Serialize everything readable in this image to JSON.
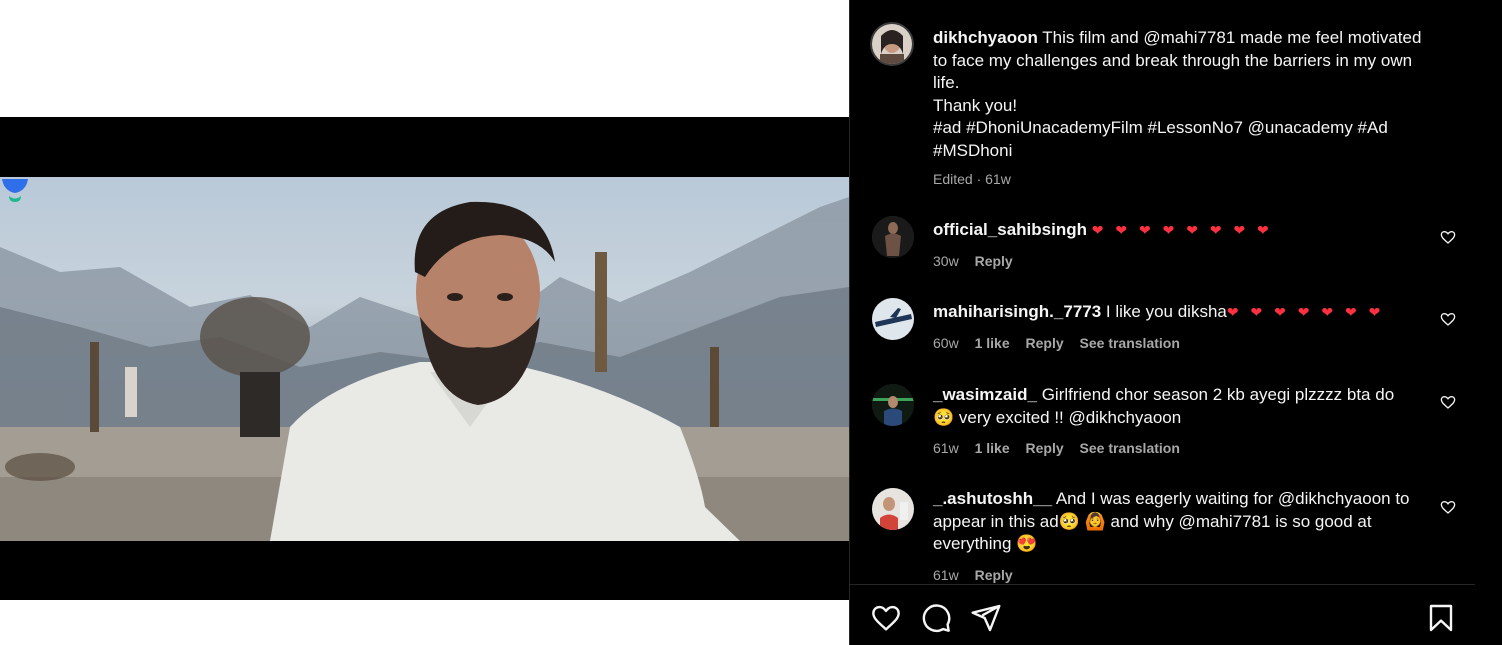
{
  "post": {
    "author": "dikhchyaoon",
    "caption_line1": "This film and @mahi7781 made me feel motivated",
    "caption_line2": "to face my challenges and break through the barriers in my own",
    "caption_line3": "life.",
    "caption_line4": "Thank you!",
    "caption_line5": "#ad #DhoniUnacademyFilm #LessonNo7 @unacademy #Ad",
    "caption_line6": "#MSDhoni",
    "edited": "Edited · 61w"
  },
  "comments": [
    {
      "user": "official_sahibsingh",
      "text": "",
      "hearts": "❤ ❤ ❤ ❤ ❤ ❤ ❤ ❤",
      "age": "30w",
      "reply": "Reply"
    },
    {
      "user": "mahiharisingh._7773",
      "text": "I like you diksha",
      "hearts": "❤ ❤ ❤ ❤ ❤ ❤ ❤",
      "age": "60w",
      "likes": "1 like",
      "reply": "Reply",
      "translate": "See translation"
    },
    {
      "user": "_wasimzaid_",
      "text_line1": "Girlfriend chor season 2 kb ayegi plzzzz bta do",
      "text_line2": "very excited !! @dikhchyaoon",
      "age": "61w",
      "likes": "1 like",
      "reply": "Reply",
      "translate": "See translation"
    },
    {
      "user": "_.ashutoshh__",
      "text_line1": "And I was eagerly waiting for @dikhchyaoon to",
      "text_line2a": "appear in this ad",
      "text_line2b": "and why @mahi7781 is so good at",
      "text_line3": "everything",
      "age": "61w",
      "reply": "Reply"
    }
  ],
  "icons": {
    "like": "heart-icon",
    "comment": "comment-icon",
    "share": "share-icon",
    "save": "bookmark-icon"
  },
  "colors": {
    "background": "#000000",
    "text": "#f5f5f5",
    "muted": "#a8a8a8",
    "heart_emoji": "#ff3040"
  }
}
